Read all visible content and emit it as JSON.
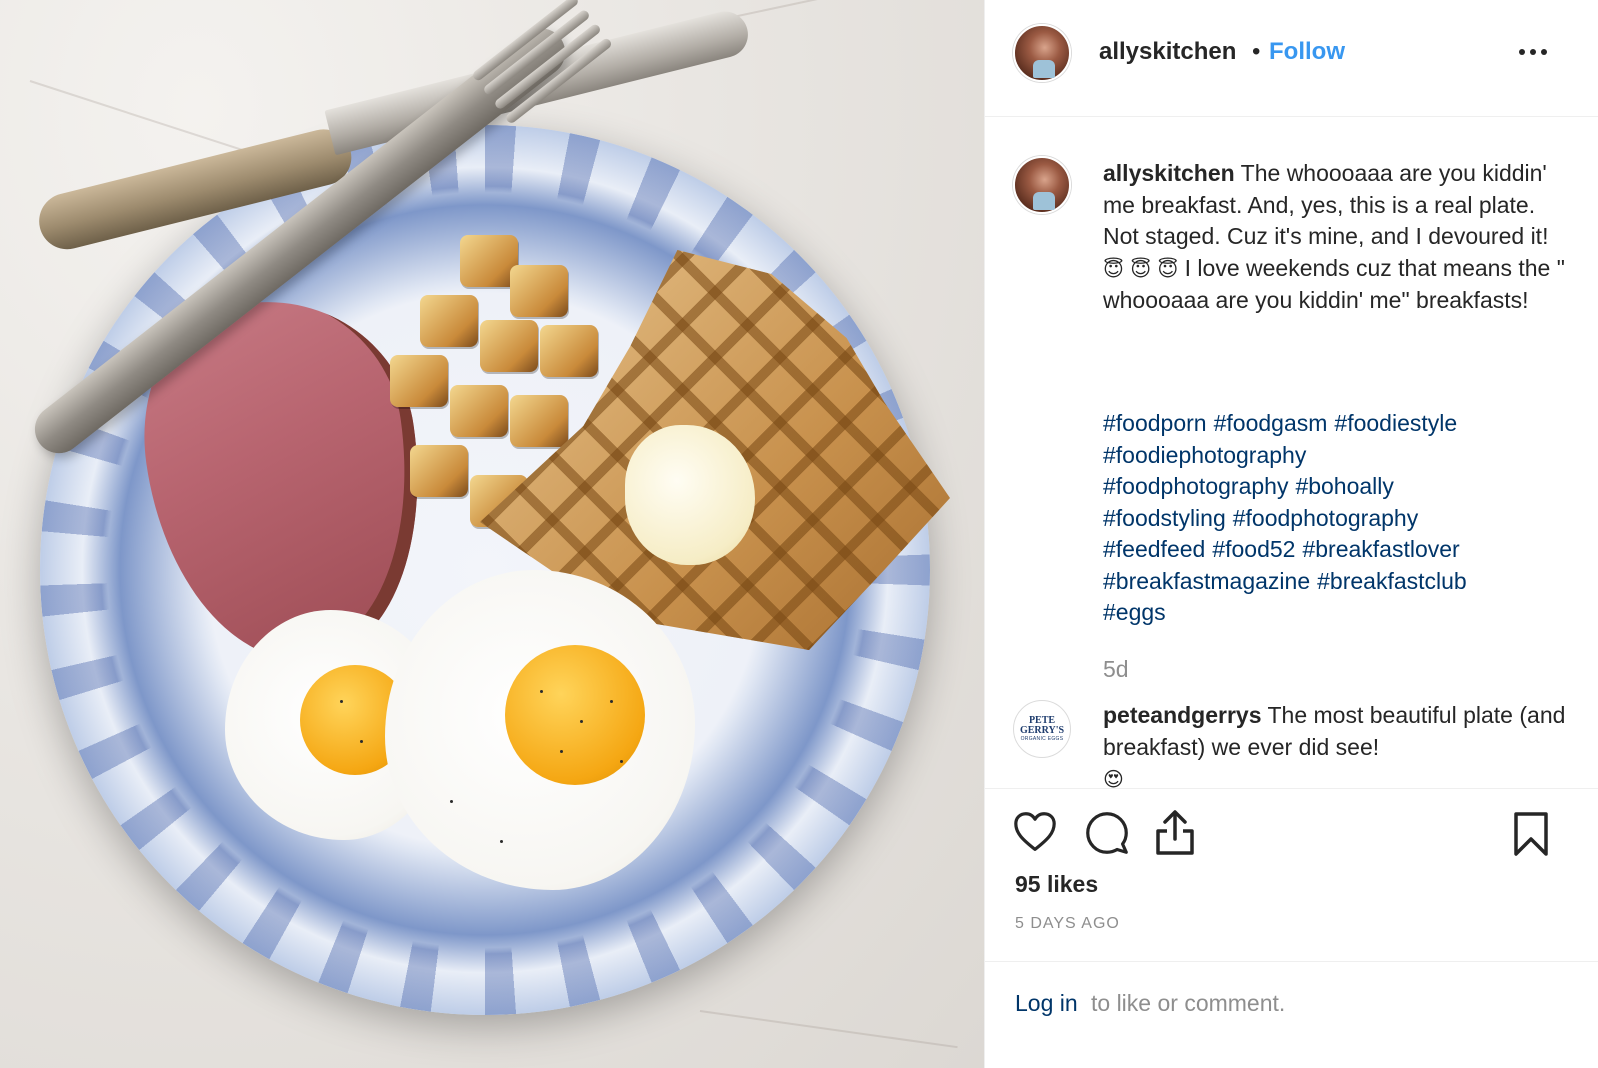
{
  "post": {
    "photo_alt": "",
    "author": "allyskitchen",
    "separator": "•",
    "follow_label": "Follow",
    "more_icon": "more-options-icon"
  },
  "caption": {
    "user": "allyskitchen",
    "text": "The whoooaaa are you kiddin' me breakfast. And, yes, this is a real plate. Not staged. Cuz it's mine, and I devoured it!",
    "emoji": "😇 😇 😇",
    "text2": "I love weekends cuz that means the \" whoooaaa are you kiddin' me\" breakfasts!",
    "hashtags": [
      "#foodporn",
      "#foodgasm",
      "#foodiestyle",
      "#foodiephotography",
      "#foodphotography",
      "#bohoally",
      "#foodstyling",
      "#foodphotography",
      "#feedfeed",
      "#food52",
      "#breakfastlover",
      "#breakfastmagazine",
      "#breakfastclub",
      "#eggs"
    ],
    "age": "5d"
  },
  "reply": {
    "user": "peteandgerrys",
    "text": "The most beautiful plate (and breakfast) we ever did see!",
    "emoji": "😍",
    "avatar_logo_line1": "PETE",
    "avatar_logo_line2": "GERRY'S",
    "avatar_logo_sub": "ORGANIC EGGS"
  },
  "actions": {
    "like_icon": "heart-icon",
    "comment_icon": "comment-icon",
    "share_icon": "share-icon",
    "save_icon": "bookmark-icon",
    "likes_text": "95 likes",
    "timestamp": "5 days ago"
  },
  "login": {
    "link": "Log in",
    "rest": "to like or comment."
  },
  "colors": {
    "follow": "#3897f0",
    "hashtag": "#003569",
    "muted": "#8e8e8e",
    "text": "#262626"
  }
}
